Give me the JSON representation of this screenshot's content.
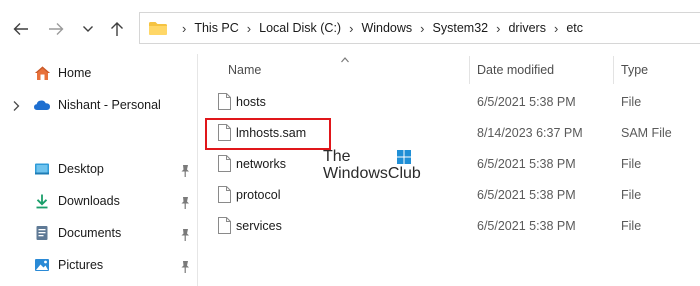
{
  "address_bar": {
    "crumbs": [
      {
        "label": "This PC"
      },
      {
        "label": "Local Disk (C:)"
      },
      {
        "label": "Windows"
      },
      {
        "label": "System32"
      },
      {
        "label": "drivers"
      },
      {
        "label": "etc"
      }
    ],
    "separator": "›"
  },
  "sidebar": {
    "items": [
      {
        "label": "Home",
        "icon": "home-icon"
      },
      {
        "label": "Nishant - Personal",
        "icon": "onedrive-icon"
      },
      {
        "label": "Desktop",
        "icon": "desktop-icon",
        "pinned": true
      },
      {
        "label": "Downloads",
        "icon": "download-icon",
        "pinned": true
      },
      {
        "label": "Documents",
        "icon": "documents-icon",
        "pinned": true
      },
      {
        "label": "Pictures",
        "icon": "pictures-icon",
        "pinned": true
      }
    ]
  },
  "list": {
    "columns": {
      "name": "Name",
      "date": "Date modified",
      "type": "Type"
    },
    "sort_column": "Name",
    "files": [
      {
        "name": "hosts",
        "date": "6/5/2021 5:38 PM",
        "type": "File"
      },
      {
        "name": "lmhosts.sam",
        "date": "8/14/2023 6:37 PM",
        "type": "SAM File",
        "highlighted": true
      },
      {
        "name": "networks",
        "date": "6/5/2021 5:38 PM",
        "type": "File"
      },
      {
        "name": "protocol",
        "date": "6/5/2021 5:38 PM",
        "type": "File"
      },
      {
        "name": "services",
        "date": "6/5/2021 5:38 PM",
        "type": "File"
      }
    ]
  },
  "watermark": {
    "line1": "The",
    "line2": "WindowsClub"
  },
  "colors": {
    "highlight": "#e0161a",
    "folder": "#f5c342",
    "accent": "#0f6cbd"
  }
}
